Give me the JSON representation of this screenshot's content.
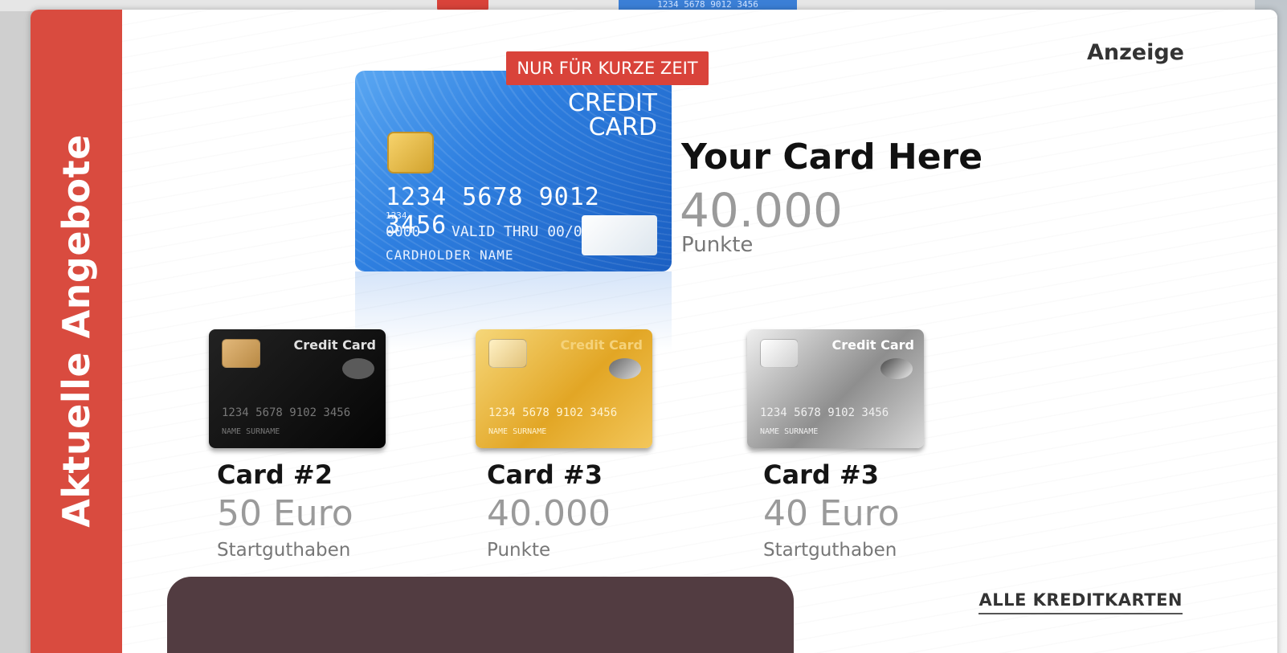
{
  "background": {
    "blue_card_number": "1234 5678 9012 3456"
  },
  "sidebar": {
    "title": "Aktuelle Angebote"
  },
  "header": {
    "ad_label": "Anzeige"
  },
  "featured": {
    "badge": "NUR FÜR KURZE ZEIT",
    "card": {
      "label_line1": "CREDIT",
      "label_line2": "CARD",
      "number": "1234 5678 9012 3456",
      "small_number": "1234",
      "code": "0000",
      "valid": "VALID THRU 00/00",
      "holder": "CARDHOLDER NAME"
    },
    "title": "Your Card Here",
    "value": "40.000",
    "unit": "Punkte"
  },
  "offers": [
    {
      "card_label": "Credit Card",
      "card_number": "1234 5678 9102 3456",
      "card_name": "NAME SURNAME",
      "title": "Card #2",
      "value": "50 Euro",
      "unit": "Startguthaben"
    },
    {
      "card_label": "Credit Card",
      "card_number": "1234 5678 9102 3456",
      "card_name": "NAME SURNAME",
      "title": "Card #3",
      "value": "40.000",
      "unit": "Punkte"
    },
    {
      "card_label": "Credit Card",
      "card_number": "1234 5678 9102 3456",
      "card_name": "NAME SURNAME",
      "title": "Card #3",
      "value": "40 Euro",
      "unit": "Startguthaben"
    }
  ],
  "footer": {
    "all_cards_link": "ALLE KREDITKARTEN"
  },
  "colors": {
    "accent": "#d9433a",
    "panel": "#523c41"
  }
}
